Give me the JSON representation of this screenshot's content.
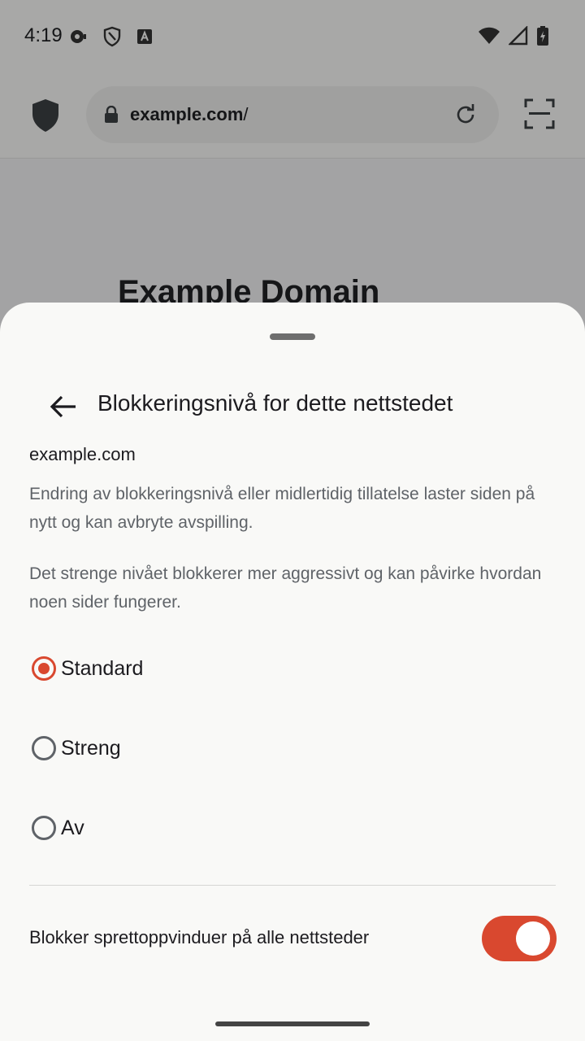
{
  "status_bar": {
    "time": "4:19",
    "left_icons": [
      "media-icon",
      "vpn-shield-icon",
      "font-icon"
    ],
    "right_icons": [
      "wifi-icon",
      "signal-icon",
      "battery-charging-icon"
    ]
  },
  "browser": {
    "url_host": "example.com",
    "url_path": "/",
    "page_heading": "Example Domain"
  },
  "sheet": {
    "title": "Blokkeringsnivå for dette nettstedet",
    "site": "example.com",
    "description_1": "Endring av blokkeringsnivå eller midlertidig tillatelse laster siden på nytt og kan avbryte avspilling.",
    "description_2": "Det strenge nivået blokkerer mer aggressivt og kan påvirke hvordan noen sider fungerer.",
    "options": [
      {
        "label": "Standard",
        "selected": true
      },
      {
        "label": "Streng",
        "selected": false
      },
      {
        "label": "Av",
        "selected": false
      }
    ],
    "popup_toggle": {
      "label": "Blokker sprettoppvinduer på alle nettsteder",
      "on": true
    }
  },
  "colors": {
    "accent": "#d9482f",
    "sheet_bg": "#f9f9f7",
    "text_secondary": "#5f6368"
  }
}
